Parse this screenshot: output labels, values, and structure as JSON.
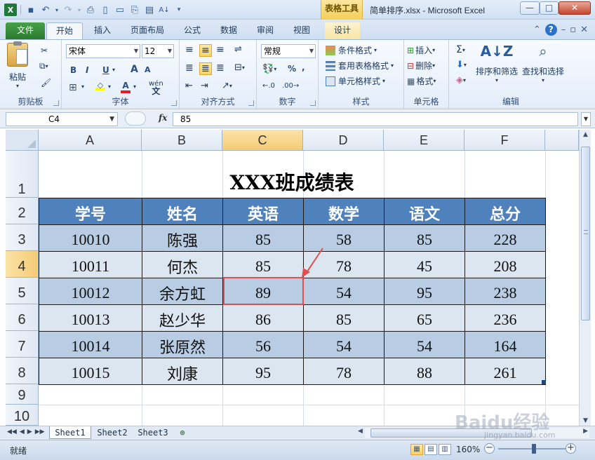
{
  "titlebar": {
    "context_tab": "表格工具",
    "title": "简单排序.xlsx  -  Microsoft Excel",
    "buttons": {
      "minimize": "—",
      "maximize": "□",
      "close": "✕"
    }
  },
  "tabs": {
    "file": "文件",
    "items": [
      "开始",
      "插入",
      "页面布局",
      "公式",
      "数据",
      "审阅",
      "视图"
    ],
    "design": "设计"
  },
  "ribbon": {
    "clipboard": {
      "label": "剪贴板",
      "paste": "粘贴"
    },
    "font": {
      "label": "字体",
      "family": "宋体",
      "size": "12",
      "bold": "B",
      "italic": "I",
      "underline": "U",
      "grow": "A",
      "shrink": "A",
      "phonetic": "wén"
    },
    "alignment": {
      "label": "对齐方式"
    },
    "number": {
      "label": "数字",
      "format": "常规",
      "percent": "%",
      "comma": ","
    },
    "styles": {
      "label": "样式",
      "conditional": "条件格式",
      "table": "套用表格格式",
      "cell": "单元格样式"
    },
    "cells": {
      "label": "单元格",
      "insert": "插入",
      "delete": "删除",
      "format": "格式"
    },
    "editing": {
      "label": "编辑",
      "sort": "排序和筛选",
      "find": "查找和选择"
    }
  },
  "formula_bar": {
    "name_box": "C4",
    "fx": "fx",
    "content": "85"
  },
  "grid": {
    "columns": [
      "A",
      "B",
      "C",
      "D",
      "E",
      "F"
    ],
    "rows": [
      "1",
      "2",
      "3",
      "4",
      "5",
      "6",
      "7",
      "8",
      "9",
      "10"
    ],
    "sheet_title": "XXX班成绩表",
    "headers": [
      "学号",
      "姓名",
      "英语",
      "数学",
      "语文",
      "总分"
    ],
    "data": [
      [
        "10010",
        "陈强",
        "85",
        "58",
        "85",
        "228"
      ],
      [
        "10011",
        "何杰",
        "85",
        "78",
        "45",
        "208"
      ],
      [
        "10012",
        "余方虹",
        "89",
        "54",
        "95",
        "238"
      ],
      [
        "10013",
        "赵少华",
        "86",
        "85",
        "65",
        "236"
      ],
      [
        "10014",
        "张原然",
        "56",
        "54",
        "54",
        "164"
      ],
      [
        "10015",
        "刘康",
        "95",
        "78",
        "88",
        "261"
      ]
    ]
  },
  "sheets": [
    "Sheet1",
    "Sheet2",
    "Sheet3"
  ],
  "status": {
    "ready": "就绪",
    "zoom": "160%"
  },
  "watermark": {
    "logo": "Baidu经验",
    "url": "jingyan.baidu.com"
  },
  "colors": {
    "header_fill": "#4f81bd",
    "band_dark": "#b8cce4",
    "band_light": "#dce6f1",
    "annotation_red": "#e05050"
  }
}
